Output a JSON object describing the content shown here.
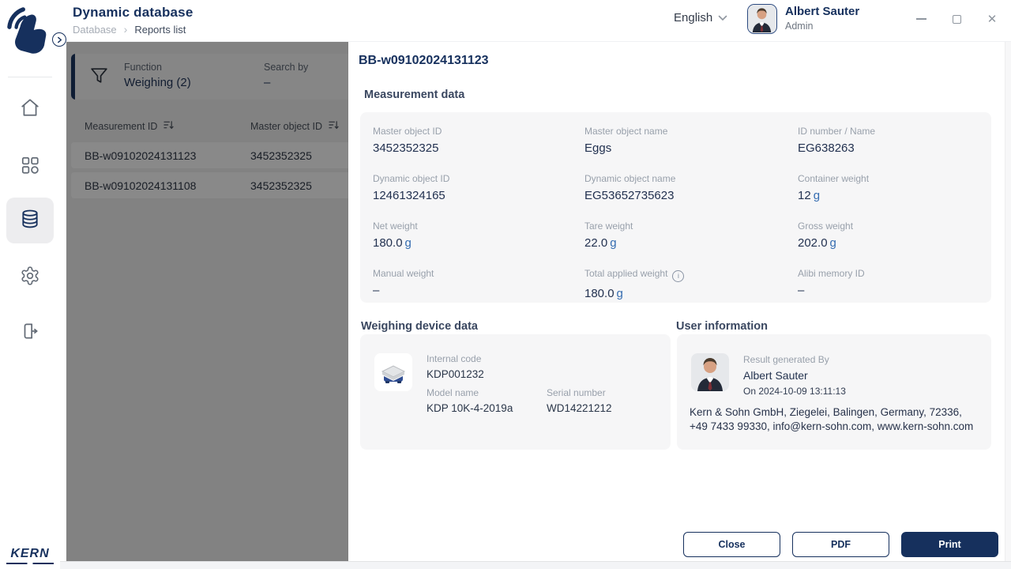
{
  "app": {
    "title": "Dynamic database"
  },
  "breadcrumb": {
    "parent": "Database",
    "current": "Reports list"
  },
  "header": {
    "language": "English",
    "user_name": "Albert Sauter",
    "user_role": "Admin"
  },
  "sidebar": {
    "brand": "KERN"
  },
  "filter": {
    "function_label": "Function",
    "function_value": "Weighing (2)",
    "search_label": "Search by",
    "search_value": "–"
  },
  "table": {
    "col_measurement": "Measurement ID",
    "col_master": "Master object ID",
    "rows": [
      {
        "measurement_id": "BB-w09102024131123",
        "master_object_id": "3452352325"
      },
      {
        "measurement_id": "BB-w09102024131108",
        "master_object_id": "3452352325"
      }
    ]
  },
  "detail": {
    "title": "BB-w09102024131123",
    "measurement_heading": "Measurement data",
    "fields": [
      {
        "label": "Master object ID",
        "value": "3452352325",
        "unit": ""
      },
      {
        "label": "Master object name",
        "value": "Eggs",
        "unit": ""
      },
      {
        "label": "ID number / Name",
        "value": "EG638263",
        "unit": ""
      },
      {
        "label": "Dynamic object ID",
        "value": "12461324165",
        "unit": ""
      },
      {
        "label": "Dynamic object name",
        "value": "EG53652735623",
        "unit": ""
      },
      {
        "label": "Container weight",
        "value": "12",
        "unit": "g"
      },
      {
        "label": "Net weight",
        "value": "180.0",
        "unit": "g"
      },
      {
        "label": "Tare weight",
        "value": "22.0",
        "unit": "g"
      },
      {
        "label": "Gross weight",
        "value": "202.0",
        "unit": "g"
      },
      {
        "label": "Manual weight",
        "value": "–",
        "unit": ""
      },
      {
        "label": "Total applied weight",
        "value": "180.0",
        "unit": "g"
      },
      {
        "label": "Alibi memory ID",
        "value": "–",
        "unit": ""
      }
    ],
    "device_heading": "Weighing device data",
    "device": {
      "internal_code_label": "Internal code",
      "internal_code": "KDP001232",
      "model_label": "Model name",
      "model": "KDP 10K-4-2019a",
      "serial_label": "Serial number",
      "serial": "WD14221212"
    },
    "user_heading": "User information",
    "user": {
      "generated_label": "Result generated By",
      "name": "Albert Sauter",
      "timestamp": "On 2024-10-09 13:11:13",
      "company": "Kern & Sohn GmbH, Ziegelei, Balingen, Germany, 72336, +49 7433 99330, info@kern-sohn.com, www.kern-sohn.com"
    },
    "buttons": {
      "close": "Close",
      "pdf": "PDF",
      "print": "Print"
    }
  },
  "colors": {
    "brand": "#16305d",
    "unit": "#346cb0"
  }
}
